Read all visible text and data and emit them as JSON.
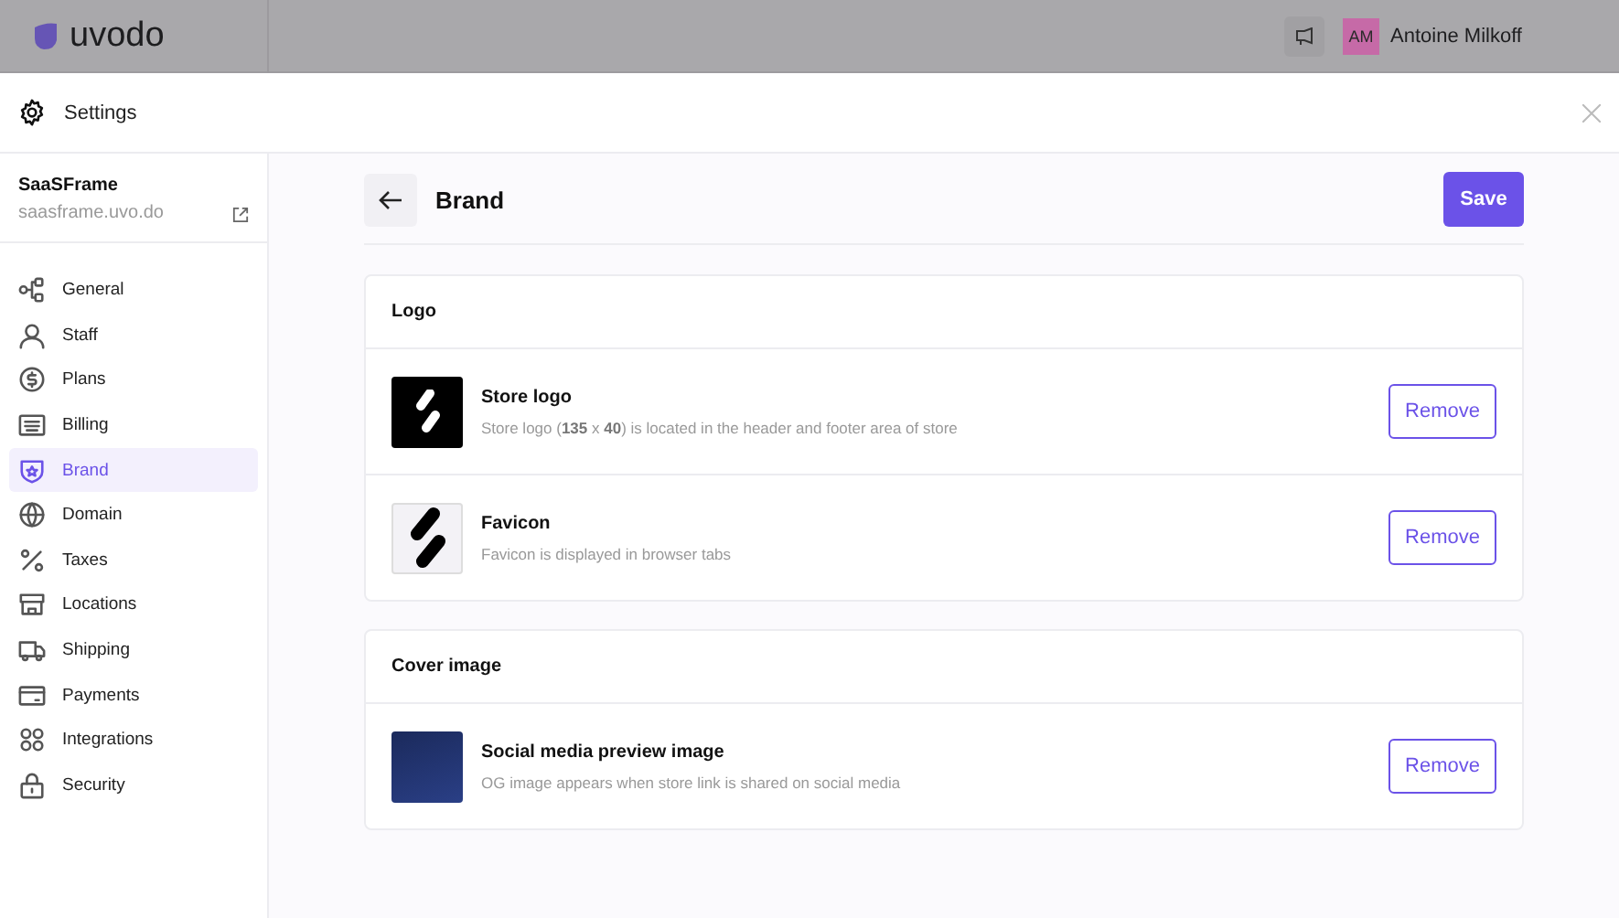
{
  "topbar": {
    "logo": "uvodo",
    "user": {
      "initials": "AM",
      "name": "Antoine Milkoff"
    }
  },
  "header": {
    "title": "Settings"
  },
  "store": {
    "name": "SaaSFrame",
    "domain": "saasframe.uvo.do"
  },
  "sidebar": {
    "items": [
      {
        "label": "General",
        "selected": false
      },
      {
        "label": "Staff",
        "selected": false
      },
      {
        "label": "Plans",
        "selected": false
      },
      {
        "label": "Billing",
        "selected": false
      },
      {
        "label": "Brand",
        "selected": true
      },
      {
        "label": "Domain",
        "selected": false
      },
      {
        "label": "Taxes",
        "selected": false
      },
      {
        "label": "Locations",
        "selected": false
      },
      {
        "label": "Shipping",
        "selected": false
      },
      {
        "label": "Payments",
        "selected": false
      },
      {
        "label": "Integrations",
        "selected": false
      },
      {
        "label": "Security",
        "selected": false
      }
    ]
  },
  "page": {
    "title": "Brand",
    "save": "Save"
  },
  "sections": [
    {
      "title": "Logo",
      "items": [
        {
          "kind": "logo-dark",
          "name": "Store logo",
          "description": "Store logo (**135** x **40**) is located in the header and footer area of store",
          "action": "Remove"
        },
        {
          "kind": "logo-light",
          "name": "Favicon",
          "description": "Favicon is displayed in browser tabs",
          "action": "Remove"
        }
      ]
    },
    {
      "title": "Cover image",
      "items": [
        {
          "kind": "photo",
          "name": "Social media preview image",
          "description": "OG image appears when store link is shared on social media",
          "action": "Remove"
        }
      ]
    }
  ]
}
